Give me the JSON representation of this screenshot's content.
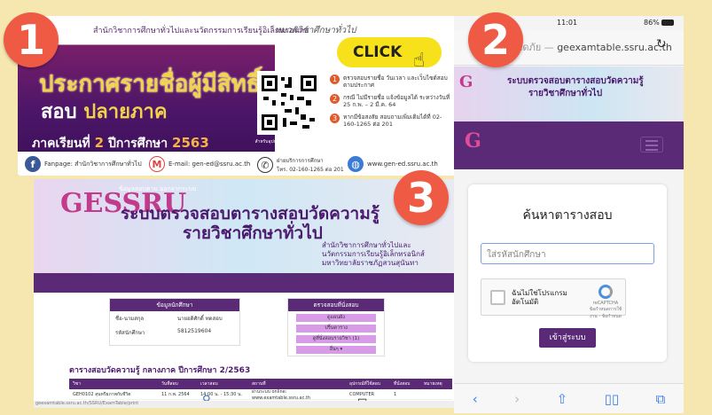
{
  "markers": {
    "m1": "1",
    "m2": "2",
    "m3": "3"
  },
  "poster": {
    "header_org": "สำนักวิชาการศึกษาทั่วไปและนวัตกรรมการเรียนรู้อิเล็กทรอนิกส์",
    "tag": "หมวดวิชาศึกษาทั่วไป",
    "click_label": "CLICK",
    "headline": "ประกาศรายชื่อผู้มีสิทธิ์",
    "subhead_a": "สอบ",
    "subhead_b": "ปลายภาค",
    "semester_prefix": "ภาคเรียนที่",
    "semester_num": "2",
    "year_prefix": "ปีการศึกษา",
    "year": "2563",
    "qr_caption": "สำหรับอุปกรณ์มือถือรองรับการสแกน",
    "steps": [
      {
        "n": "1",
        "text": "ตรวจสอบรายชื่อ วันเวลา และเว็บไซต์สอบตามประกาศ"
      },
      {
        "n": "2",
        "text": "กรณี ไม่มีรายชื่อ แจ้งข้อมูลได้ ระหว่างวันที่ 25 ก.พ. – 2 มี.ค. 64"
      },
      {
        "n": "3",
        "text": "หากมีข้อสงสัย สอบถามเพิ่มเติมได้ที่ 02-160-1265 ต่อ 201"
      }
    ],
    "footer": {
      "fanpage": "Fanpage: สำนักวิชาการศึกษาทั่วไป",
      "email": "E-mail: gen-ed@ssru.ac.th",
      "phone_line1": "ฝ่ายบริการการศึกษา",
      "phone_line2": "โทร. 02-160-1265 ต่อ 201",
      "website": "www.gen-ed.ssru.ac.th"
    }
  },
  "desktop": {
    "logo": "GESSRU",
    "title_1": "ระบบตรวจสอบตารางสอบวัดความรู้",
    "title_2": "รายวิชาศึกษาทั่วไป",
    "org_1": "สำนักวิชาการศึกษาทั่วไปและ",
    "org_2": "นวัตกรรมการเรียนรู้อิเล็กทรอนิกส์",
    "org_3": "มหาวิทยาลัยราชภัฏสวนสุนันทา",
    "nav_text": "ข้อมูลสอบตาม  ออกจากระบบ",
    "student_box": {
      "title": "ข้อมูลนักศึกษา",
      "name_label": "ชื่อ-นามสกุล",
      "name_val": "นายอดิศักดิ์ ทดสอบ",
      "id_label": "รหัสนักศึกษา",
      "id_val": "5812519604"
    },
    "exam_box": {
      "title": "ตรวจสอบที่นั่งสอบ",
      "btns": [
        "ดูแผนผัง",
        "ปริ้นตาราง",
        "ดูที่นั่งสอบรายวิชา (1)",
        "อื่นๆ ▾"
      ]
    },
    "exam_heading": "ตารางสอบวัดความรู้ กลางภาค ปีการศึกษา 2/2563",
    "table_headers": [
      "วิชา",
      "วันที่สอบ",
      "เวลาสอบ",
      "สถานที่",
      "อุปกรณ์ที่ใช้สอบ",
      "ที่นั่งสอบ",
      "หมายเหตุ"
    ],
    "table_row": [
      "GEH0102 สุนทรียภาพกับชีวิต",
      "11 ก.พ. 2564",
      "14:00 น. - 15:30 น.",
      "ผ่านระบบ online: www.examtable.ssru.ac.th",
      "COMPUTER",
      "1",
      ""
    ],
    "status_url": "geexamtable.ssru.ac.th/SSRU/ExamTable/print"
  },
  "phone": {
    "time": "11:01",
    "battery": "86%",
    "url_prefix": "ลอดภัย — ",
    "url": "geexamtable.ssru.ac.th",
    "banner_1": "ระบบตรวจสอบตารางสอบวัดความรู้",
    "banner_2": "รายวิชาศึกษาทั่วไป",
    "logo": "G",
    "card_title": "ค้นหาตารางสอบ",
    "input_placeholder": "ใส่รหัสนักศึกษา",
    "captcha_text_1": "ฉันไม่ใช่โปรแกรม",
    "captcha_text_2": "อัตโนมัติ",
    "captcha_brand": "reCAPTCHA",
    "captcha_links": "ข้อกำหนดการใช้งาน - ข้อกำหนด",
    "login_label": "เข้าสู่ระบบ",
    "toolbar_icons": [
      "chevron-left-icon",
      "chevron-right-icon",
      "share-icon",
      "bookmarks-icon",
      "tabs-icon"
    ]
  },
  "colors": {
    "background": "#f6e7b1",
    "marker": "#ef5a45",
    "purple": "#5b2a77",
    "click": "#f7e11a"
  }
}
